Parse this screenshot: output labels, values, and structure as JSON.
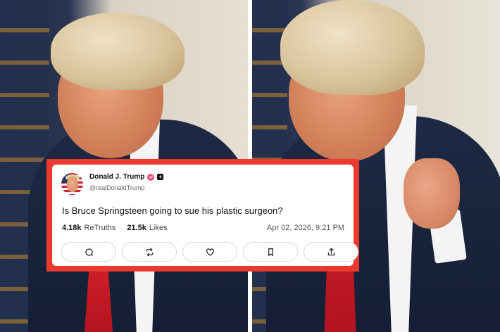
{
  "post": {
    "display_name": "Donald J. Trump",
    "handle": "@realDonaldTrump",
    "text": "Is Bruce Springsteen going to sue his plastic surgeon?",
    "retruths_count": "4.18k",
    "retruths_label": "ReTruths",
    "likes_count": "21.5k",
    "likes_label": "Likes",
    "timestamp": "Apr 02, 2026, 9:21 PM"
  },
  "actions": [
    {
      "icon": "reply-icon"
    },
    {
      "icon": "retruth-icon"
    },
    {
      "icon": "heart-icon"
    },
    {
      "icon": "bookmark-icon"
    },
    {
      "icon": "share-icon"
    }
  ],
  "colors": {
    "frame_red": "#ea3a2f",
    "verified_pink": "#ee4f72",
    "tie_red": "#d4202c",
    "suit_navy": "#1e2a45"
  }
}
